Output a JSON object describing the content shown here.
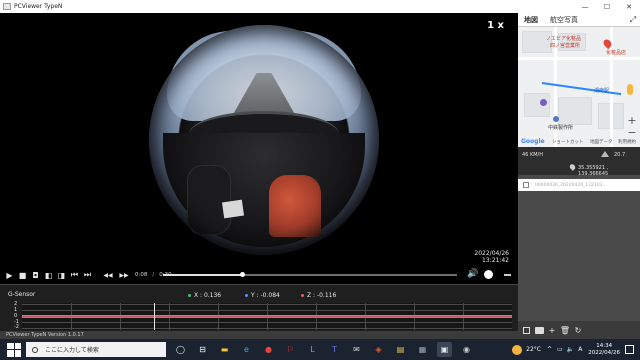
{
  "window": {
    "title": "PCViewer TypeN",
    "minimize_glyph": "—",
    "maximize_glyph": "☐",
    "close_glyph": "✕"
  },
  "video": {
    "speed_indicator": "1 x",
    "timestamp_date": "2022/04/26",
    "timestamp_time": "13:21:42"
  },
  "player": {
    "current_time": "0:08",
    "separator": "/",
    "total_time": "0:30",
    "progress_fraction": 0.27,
    "buttons": {
      "play": "▶",
      "stop": "■",
      "snapshot": "◘",
      "frame_prev": "◧",
      "frame_next": "◨",
      "skip_start": "⏮",
      "skip_end": "⏭",
      "rewind": "◀◀",
      "forward": "▶▶",
      "volume": "🔊"
    }
  },
  "gsensor": {
    "title": "G-Sensor",
    "x_label": "X : 0.136",
    "y_label": "Y : -0.084",
    "z_label": "Z : -0.116",
    "x_color": "#3fc26a",
    "y_color": "#5b8cff",
    "z_color": "#e05a6a",
    "y_ticks": [
      "2",
      "1",
      "0",
      "-1",
      "-2"
    ]
  },
  "version": {
    "text": "PCViewer TypeN Version 1.0.17"
  },
  "map": {
    "tabs": [
      "地図",
      "航空写真"
    ],
    "expand_glyph": "⤢",
    "labels": {
      "store": "ノエビア化粧品",
      "store2": "四ノ宮営業所",
      "store3": "化粧品店",
      "station": "湖南駅",
      "company": "中鉄製作所"
    },
    "zoom_in": "+",
    "zoom_out": "−",
    "google": "Google",
    "footer_shortcut": "ショートカット",
    "footer_mapdata": "地図データ",
    "footer_terms": "利用規約",
    "route_color": "#2a88ff"
  },
  "gps": {
    "speed": "46 KM/H",
    "altitude": "20.7",
    "coordinates": "35.355921 , 139.366645"
  },
  "files": {
    "rows": [
      {
        "name": "00000036_20220426_132103..."
      }
    ]
  },
  "file_tools": {
    "select": "☐",
    "open": "folder",
    "add": "+",
    "delete": "🗑",
    "refresh": "↻"
  },
  "taskbar": {
    "search_placeholder": "ここに入力して検索",
    "task_view": "◯",
    "temperature": "22°C",
    "ime": "A",
    "time": "14:34",
    "date": "2022/04/26",
    "tray_chevron": "^",
    "speaker": "🔈",
    "network": "▭",
    "apps": [
      {
        "name": "task-view",
        "glyph": "⊟",
        "bg": "#1b2330",
        "fg": "#ffffff"
      },
      {
        "name": "files",
        "glyph": "▬",
        "bg": "#1b2330",
        "fg": "#f5c342"
      },
      {
        "name": "edge",
        "glyph": "e",
        "bg": "#1b2330",
        "fg": "#3aa8e8"
      },
      {
        "name": "chrome",
        "glyph": "●",
        "bg": "#1b2330",
        "fg": "#e6463a"
      },
      {
        "name": "acrobat",
        "glyph": "⚐",
        "bg": "#1b2330",
        "fg": "#ec3c37"
      },
      {
        "name": "line",
        "glyph": "L",
        "bg": "#1b2330",
        "fg": "#3fd24f"
      },
      {
        "name": "teams",
        "glyph": "T",
        "bg": "#1b2330",
        "fg": "#6c74e8"
      },
      {
        "name": "mail",
        "glyph": "✉",
        "bg": "#1b2330",
        "fg": "#d6d6d6"
      },
      {
        "name": "office",
        "glyph": "◈",
        "bg": "#1b2330",
        "fg": "#e2612c"
      },
      {
        "name": "notes",
        "glyph": "▤",
        "bg": "#1b2330",
        "fg": "#f2c64a"
      },
      {
        "name": "photos",
        "glyph": "▦",
        "bg": "#1b2330",
        "fg": "#9fa7b5"
      },
      {
        "name": "pcviewer",
        "glyph": "▣",
        "bg": "#3a4558",
        "fg": "#e8e8e8"
      },
      {
        "name": "viewer",
        "glyph": "◉",
        "bg": "#1b2330",
        "fg": "#c9c9c9"
      }
    ]
  }
}
